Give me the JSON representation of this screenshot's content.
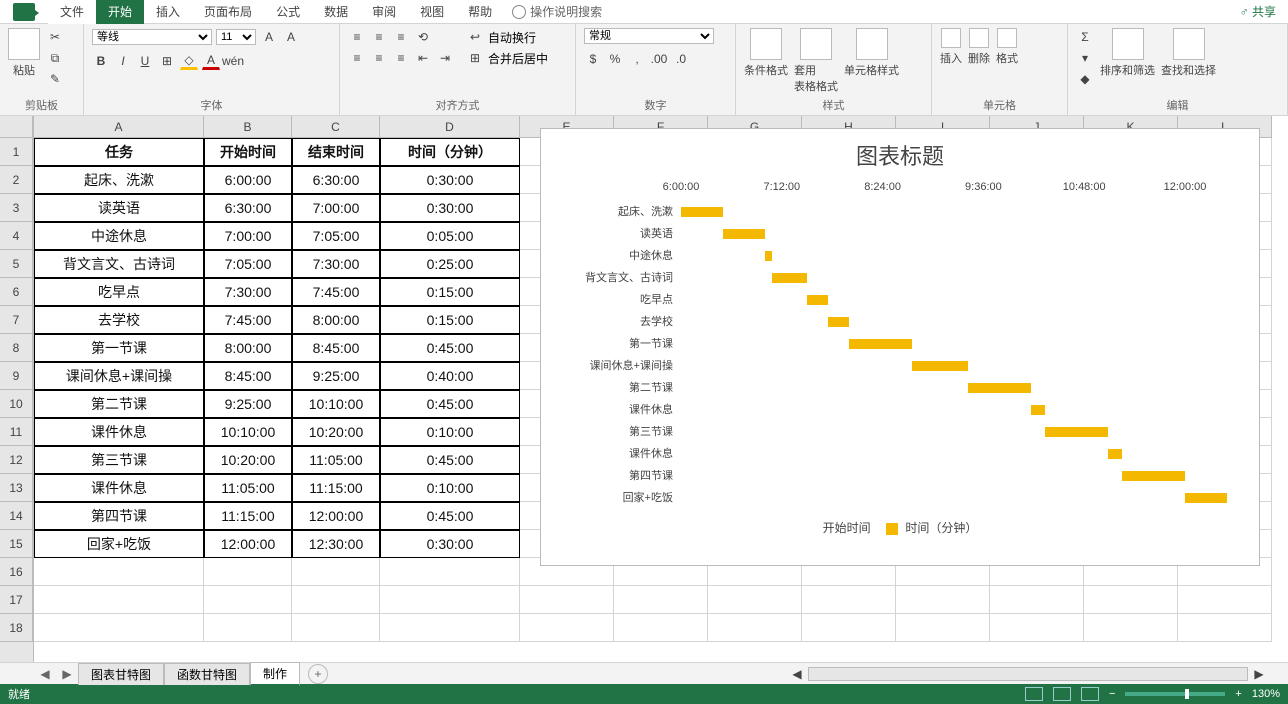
{
  "menu": {
    "file": "文件",
    "home": "开始",
    "insert": "插入",
    "layout": "页面布局",
    "formula": "公式",
    "data": "数据",
    "review": "审阅",
    "view": "视图",
    "help": "帮助",
    "tellme": "操作说明搜索",
    "share": "共享"
  },
  "ribbon": {
    "clipboard": {
      "paste": "粘贴",
      "label": "剪贴板"
    },
    "font": {
      "name": "等线",
      "size": "11",
      "label": "字体"
    },
    "align": {
      "wrap": "自动换行",
      "merge": "合并后居中",
      "label": "对齐方式"
    },
    "number": {
      "format": "常规",
      "label": "数字"
    },
    "styles": {
      "cond": "条件格式",
      "table": "套用\n表格格式",
      "cell": "单元格样式",
      "label": "样式"
    },
    "cells": {
      "insert": "插入",
      "delete": "删除",
      "format": "格式",
      "label": "单元格"
    },
    "edit": {
      "sort": "排序和筛选",
      "find": "查找和选择",
      "label": "编辑"
    }
  },
  "columns": [
    "A",
    "B",
    "C",
    "D",
    "E",
    "F",
    "G",
    "H",
    "I",
    "J",
    "K",
    "L"
  ],
  "rows": [
    "1",
    "2",
    "3",
    "4",
    "5",
    "6",
    "7",
    "8",
    "9",
    "10",
    "11",
    "12",
    "13",
    "14",
    "15",
    "16",
    "17",
    "18"
  ],
  "table": {
    "headers": [
      "任务",
      "开始时间",
      "结束时间",
      "时间（分钟）"
    ],
    "rows": [
      [
        "起床、洗漱",
        "6:00:00",
        "6:30:00",
        "0:30:00"
      ],
      [
        "读英语",
        "6:30:00",
        "7:00:00",
        "0:30:00"
      ],
      [
        "中途休息",
        "7:00:00",
        "7:05:00",
        "0:05:00"
      ],
      [
        "背文言文、古诗词",
        "7:05:00",
        "7:30:00",
        "0:25:00"
      ],
      [
        "吃早点",
        "7:30:00",
        "7:45:00",
        "0:15:00"
      ],
      [
        "去学校",
        "7:45:00",
        "8:00:00",
        "0:15:00"
      ],
      [
        "第一节课",
        "8:00:00",
        "8:45:00",
        "0:45:00"
      ],
      [
        "课间休息+课间操",
        "8:45:00",
        "9:25:00",
        "0:40:00"
      ],
      [
        "第二节课",
        "9:25:00",
        "10:10:00",
        "0:45:00"
      ],
      [
        "课件休息",
        "10:10:00",
        "10:20:00",
        "0:10:00"
      ],
      [
        "第三节课",
        "10:20:00",
        "11:05:00",
        "0:45:00"
      ],
      [
        "课件休息",
        "11:05:00",
        "11:15:00",
        "0:10:00"
      ],
      [
        "第四节课",
        "11:15:00",
        "12:00:00",
        "0:45:00"
      ],
      [
        "回家+吃饭",
        "12:00:00",
        "12:30:00",
        "0:30:00"
      ]
    ]
  },
  "chart_data": {
    "type": "bar",
    "title": "图表标题",
    "x_ticks": [
      "6:00:00",
      "7:12:00",
      "8:24:00",
      "9:36:00",
      "10:48:00",
      "12:00:00"
    ],
    "xlim_minutes": [
      360,
      760
    ],
    "categories": [
      "起床、洗漱",
      "读英语",
      "中途休息",
      "背文言文、古诗词",
      "吃早点",
      "去学校",
      "第一节课",
      "课间休息+课间操",
      "第二节课",
      "课件休息",
      "第三节课",
      "课件休息",
      "第四节课",
      "回家+吃饭"
    ],
    "series": [
      {
        "name": "开始时间",
        "stacked_invisible": true,
        "values_minutes": [
          360,
          390,
          420,
          425,
          450,
          465,
          480,
          525,
          565,
          610,
          620,
          665,
          675,
          720
        ]
      },
      {
        "name": "时间（分钟）",
        "values_minutes": [
          30,
          30,
          5,
          25,
          15,
          15,
          45,
          40,
          45,
          10,
          45,
          10,
          45,
          30
        ]
      }
    ],
    "legend": [
      "开始时间",
      "时间（分钟）"
    ]
  },
  "tabs": {
    "t1": "图表甘特图",
    "t2": "函数甘特图",
    "t3": "制作",
    "active": "t3"
  },
  "status": {
    "ready": "就绪",
    "zoom": "130%"
  }
}
